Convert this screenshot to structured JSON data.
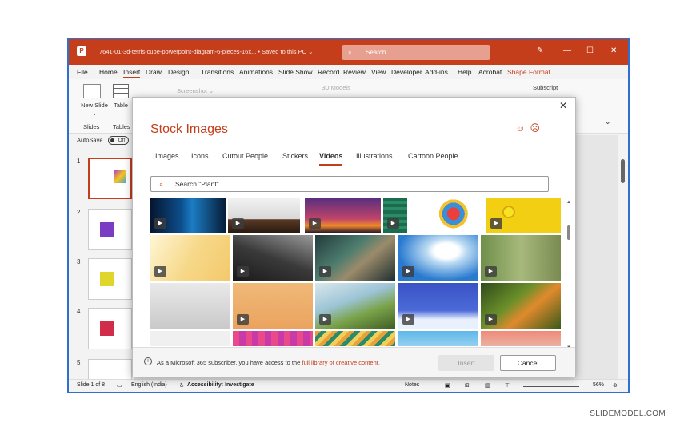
{
  "titlebar": {
    "doc_title": "7641-01-3d-tetris-cube-powerpoint-diagram-6-pieces-16x... • Saved to this PC ⌄",
    "search_placeholder": "Search"
  },
  "menu": [
    "File",
    "Home",
    "Insert",
    "Draw",
    "Design",
    "Transitions",
    "Animations",
    "Slide Show",
    "Record",
    "Review",
    "View",
    "Developer",
    "Add-ins",
    "Help",
    "Acrobat",
    "Shape Format"
  ],
  "ribbon": {
    "new_slide": "New Slide ⌄",
    "table": "Table",
    "slides_group": "Slides",
    "tables_group": "Tables",
    "screenshot": "Screenshot ⌄",
    "models": "3D Models",
    "subscript": "Subscript"
  },
  "autosave": {
    "label": "AutoSave",
    "state": "Off"
  },
  "slide_numbers": [
    "1",
    "2",
    "3",
    "4",
    "5"
  ],
  "status": {
    "slide": "Slide 1 of 8",
    "language": "English (India)",
    "accessibility": "Accessibility: Investigate",
    "notes": "Notes",
    "zoom": "56%"
  },
  "dialog": {
    "title": "Stock Images",
    "tabs": [
      "Images",
      "Icons",
      "Cutout People",
      "Stickers",
      "Videos",
      "Illustrations",
      "Cartoon People"
    ],
    "active_tab": "Videos",
    "search_placeholder": "Search \"Plant\"",
    "info": "As a Microsoft 365 subscriber, you have access to the",
    "info_link": "full library of creative content.",
    "insert": "Insert",
    "cancel": "Cancel"
  },
  "watermark": "SLIDEMODEL.COM",
  "colors": {
    "accent": "#c43e1c",
    "titlebar": "#c43e1c",
    "frame": "#2f6fd0"
  }
}
